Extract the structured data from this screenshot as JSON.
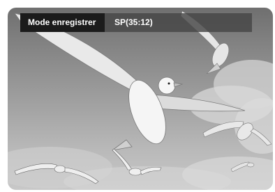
{
  "osd": {
    "label": "Mode enregistrer",
    "value": "SP(35:12)"
  }
}
